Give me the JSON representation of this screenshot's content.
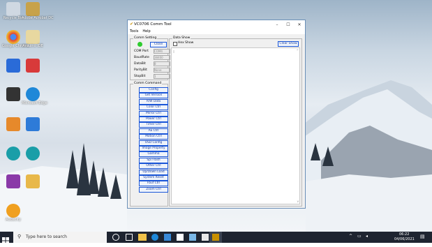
{
  "desktop_icons": [
    {
      "label": "Recycle Bin",
      "color": "#cfd8e2"
    },
    {
      "label": "Adobe Acrobat DC",
      "color": "#c7a24a"
    },
    {
      "label": "Google Chrome",
      "color": "#e34133"
    },
    {
      "label": "Arduino IDE",
      "color": "#e8d8a0"
    },
    {
      "label": "",
      "color": "#2a6bd8"
    },
    {
      "label": "",
      "color": "#d83a3a"
    },
    {
      "label": "",
      "color": "#333333"
    },
    {
      "label": "Microsoft Edge",
      "color": "#1f88d8"
    },
    {
      "label": "",
      "color": "#e6892b"
    },
    {
      "label": "",
      "color": "#2e7bd8"
    },
    {
      "label": "",
      "color": "#1a9ea8"
    },
    {
      "label": "",
      "color": "#1a9ea8"
    },
    {
      "label": "",
      "color": "#8a3aa8"
    },
    {
      "label": "",
      "color": "#e8b84a"
    },
    {
      "label": "Audacity",
      "color": "#f0a020"
    }
  ],
  "window": {
    "title": "VC0706 Comm Tool",
    "menu": [
      "Tools",
      "Help"
    ],
    "comm_setting": {
      "title": "Comm Setting",
      "close_label": "Close",
      "status_color": "#2ecc2e",
      "fields": [
        {
          "label": "COM Port",
          "value": "COM4"
        },
        {
          "label": "BaudRate",
          "value": "38400"
        },
        {
          "label": "DataBit",
          "value": "8"
        },
        {
          "label": "ParityBit",
          "value": "None"
        },
        {
          "label": "StopBit",
          "value": "1"
        }
      ]
    },
    "comm_command": {
      "title": "Comm Command",
      "buttons": [
        "Config",
        "Get Version",
        "R/W Data",
        "Color Ctrl",
        "Mirror Ctrl",
        "Power Ctrl",
        "Timer Ctrl",
        "AE Ctrl",
        "Motion Ctrl",
        "OSD Config",
        "Image Property",
        "Gamma",
        "Spi Flash",
        "Other Ctrl",
        "Up/Down Load",
        "System Reset",
        "Fbuf Ctrl",
        "Zoom Ctrl"
      ]
    },
    "data_show": {
      "title": "Data Show",
      "hex_show_label": "Hex Show",
      "clear_label": "Clear Show"
    }
  },
  "taskbar": {
    "search_placeholder": "Type here to search",
    "time": "06:22",
    "date": "04/06/2021"
  }
}
